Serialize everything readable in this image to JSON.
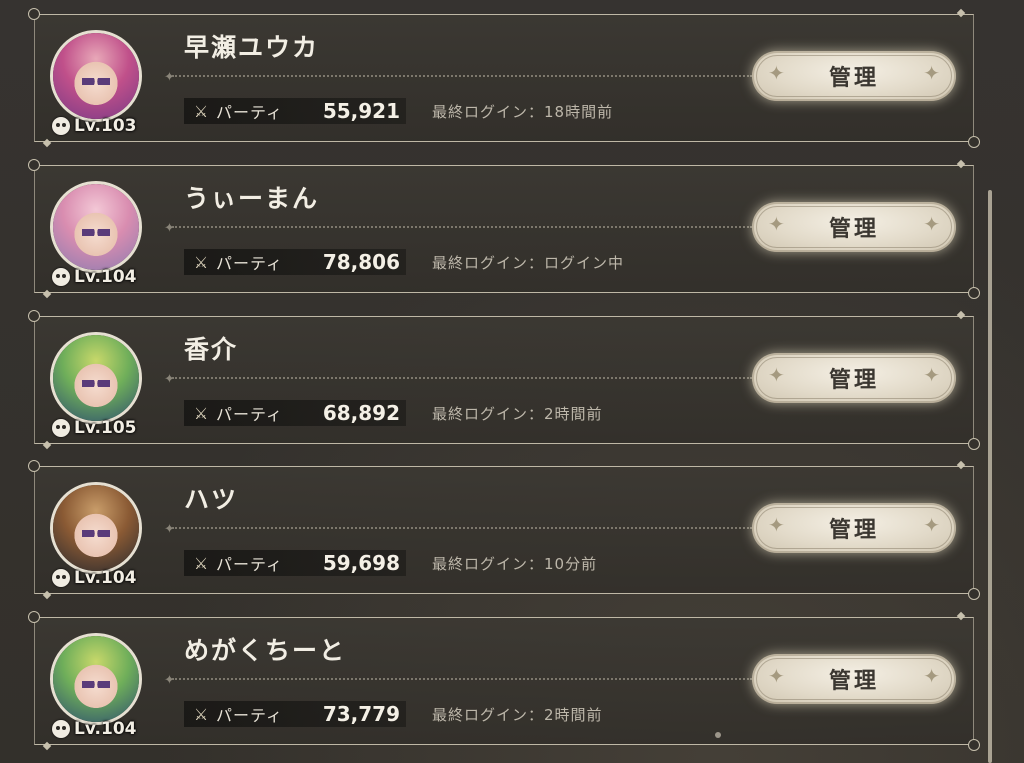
{
  "members": [
    {
      "name": "早瀬ユウカ",
      "level": "Lv.103",
      "party_label": "パーティ",
      "party_value": "55,921",
      "last_login": "最終ログイン：18時間前",
      "manage_label": "管理",
      "avatar_colors": [
        "#e8a8b8",
        "#c0508a",
        "#7a3a86"
      ]
    },
    {
      "name": "うぃーまん",
      "level": "Lv.104",
      "party_label": "パーティ",
      "party_value": "78,806",
      "last_login": "最終ログイン：ログイン中",
      "manage_label": "管理",
      "avatar_colors": [
        "#f3c8d6",
        "#d98db0",
        "#8d7bb0"
      ]
    },
    {
      "name": "香介",
      "level": "Lv.105",
      "party_label": "パーティ",
      "party_value": "68,892",
      "last_login": "最終ログイン：2時間前",
      "manage_label": "管理",
      "avatar_colors": [
        "#c8d86a",
        "#6fae5a",
        "#2d4f6f"
      ]
    },
    {
      "name": "ハツ",
      "level": "Lv.104",
      "party_label": "パーティ",
      "party_value": "59,698",
      "last_login": "最終ログイン：10分前",
      "manage_label": "管理",
      "avatar_colors": [
        "#c99d6a",
        "#8a5a34",
        "#2a2a2e"
      ]
    },
    {
      "name": "めがくちーと",
      "level": "Lv.104",
      "party_label": "パーティ",
      "party_value": "73,779",
      "last_login": "最終ログイン：2時間前",
      "manage_label": "管理",
      "avatar_colors": [
        "#c8d86a",
        "#6fae5a",
        "#2d4f6f"
      ]
    }
  ],
  "icons": {
    "party": "crossed-swords-icon",
    "level": "face-icon",
    "spark": "sparkle-icon"
  }
}
